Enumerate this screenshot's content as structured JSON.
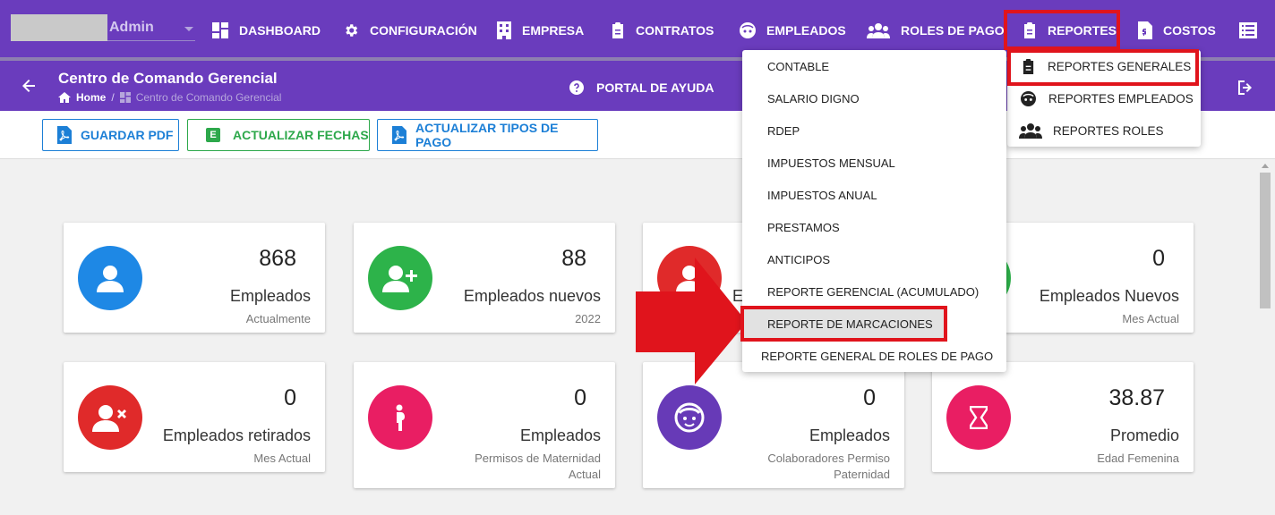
{
  "user": {
    "name": "Admin"
  },
  "nav": [
    {
      "label": "DASHBOARD",
      "icon": "dashboard-icon"
    },
    {
      "label": "CONFIGURACIÓN",
      "icon": "gear-icon"
    },
    {
      "label": "EMPRESA",
      "icon": "building-icon"
    },
    {
      "label": "CONTRATOS",
      "icon": "clipboard-icon"
    },
    {
      "label": "EMPLEADOS",
      "icon": "face-icon"
    },
    {
      "label": "ROLES DE PAGO",
      "icon": "group-icon"
    },
    {
      "label": "REPORTES",
      "icon": "clipboard-icon"
    },
    {
      "label": "COSTOS",
      "icon": "invoice-icon"
    }
  ],
  "subbar": {
    "title": "Centro de Comando Gerencial",
    "breadcrumb": {
      "home": "Home",
      "current": "Centro de Comando Gerencial"
    },
    "help": "PORTAL DE AYUDA"
  },
  "toolbar": {
    "guardar_pdf": "GUARDAR PDF",
    "actualizar_fechas": "ACTUALIZAR FECHAS",
    "actualizar_tipos": "ACTUALIZAR TIPOS DE PAGO",
    "excel_letter": "E"
  },
  "cards": [
    {
      "value": "868",
      "label": "Empleados",
      "sub": "Actualmente",
      "color": "#1e88e5"
    },
    {
      "value": "88",
      "label": "Empleados nuevos",
      "sub": "2022",
      "color": "#2db34a"
    },
    {
      "value": "",
      "label": "E",
      "sub": "",
      "color": "#e02a2a"
    },
    {
      "value": "0",
      "label": "Empleados Nuevos",
      "sub": "Mes Actual",
      "color": "#2db34a"
    },
    {
      "value": "0",
      "label": "Empleados retirados",
      "sub": "Mes Actual",
      "color": "#e02a2a"
    },
    {
      "value": "0",
      "label": "Empleados",
      "sub": "Permisos de Maternidad Actual",
      "color": "#e91e63"
    },
    {
      "value": "0",
      "label": "Empleados",
      "sub": "Colaboradores Permiso Paternidad",
      "color": "#673ab7"
    },
    {
      "value": "38.87",
      "label": "Promedio",
      "sub": "Edad Femenina",
      "color": "#e91e63"
    }
  ],
  "reportes_menu": [
    {
      "label": "REPORTES GENERALES",
      "icon": "clipboard-icon"
    },
    {
      "label": "REPORTES EMPLEADOS",
      "icon": "face-icon"
    },
    {
      "label": "REPORTES ROLES",
      "icon": "group-icon"
    }
  ],
  "generales_menu": [
    "CONTABLE",
    "SALARIO DIGNO",
    "RDEP",
    "IMPUESTOS MENSUAL",
    "IMPUESTOS ANUAL",
    "PRESTAMOS",
    "ANTICIPOS",
    "REPORTE GERENCIAL (ACUMULADO)",
    "REPORTE DE MARCACIONES",
    "REPORTE GENERAL DE ROLES DE PAGO"
  ],
  "colors": {
    "primary": "#6a3cbd",
    "highlight": "#e0141c",
    "blue": "#1c7fd6",
    "green": "#2da84b"
  }
}
